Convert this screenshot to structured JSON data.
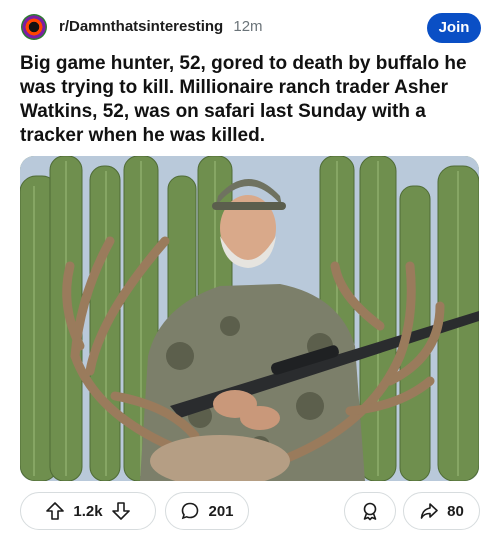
{
  "header": {
    "subreddit": "r/Damnthatsinteresting",
    "time": "12m",
    "join_label": "Join"
  },
  "post": {
    "title": "Big game hunter, 52, gored to death by buffalo he was trying to kill. Millionaire ranch trader Asher Watkins, 52, was on safari last Sunday with a tracker when he was killed."
  },
  "actions": {
    "upvotes": "1.2k",
    "comments": "201",
    "shares": "80"
  },
  "colors": {
    "join_bg": "#0a4fc5",
    "pill_border": "#d7dcde"
  }
}
